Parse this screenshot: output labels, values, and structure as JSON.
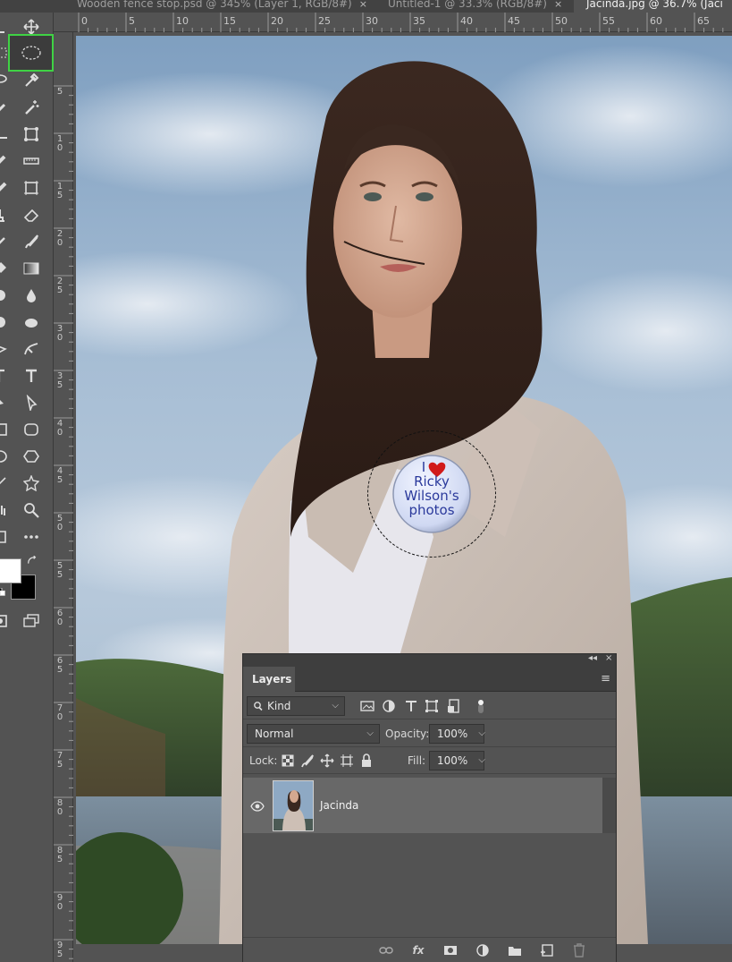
{
  "tabs": [
    {
      "label": "Wooden fence stop.psd @ 345% (Layer 1, RGB/8#)",
      "close": "×"
    },
    {
      "label": "Untitled-1 @ 33.3% (RGB/8#)",
      "close": "×"
    },
    {
      "label": "Jacinda.jpg @ 36.7% (Jaci",
      "close": ""
    }
  ],
  "ruler": {
    "top_labels": [
      "0",
      "5",
      "10",
      "15",
      "20",
      "25",
      "30",
      "35",
      "40",
      "45",
      "50",
      "55",
      "60",
      "65"
    ],
    "left_labels": [
      "5",
      "10",
      "15",
      "20",
      "25",
      "30",
      "35",
      "40",
      "45",
      "50",
      "55",
      "60",
      "65",
      "70",
      "75",
      "80",
      "85",
      "90",
      "95"
    ]
  },
  "toolbar": {
    "active_tool": "elliptical-marquee",
    "foreground_color": "#ffffff",
    "background_color": "#000000",
    "accent": "#3fd244"
  },
  "badge": {
    "line1": "I",
    "line2": "Ricky",
    "line3": "Wilson's",
    "line4": "photos",
    "text_color": "#2b3a9c",
    "heart_color": "#d11a1a"
  },
  "layers_panel": {
    "tab_label": "Layers",
    "collapse": "◂◂",
    "close": "×",
    "filter_kind": "Kind",
    "blend_mode": "Normal",
    "opacity_label": "Opacity:",
    "opacity_value": "100%",
    "lock_label": "Lock:",
    "fill_label": "Fill:",
    "fill_value": "100%",
    "layers": [
      {
        "name": "Jacinda",
        "visible": true
      }
    ],
    "footer_fx": "fx"
  }
}
